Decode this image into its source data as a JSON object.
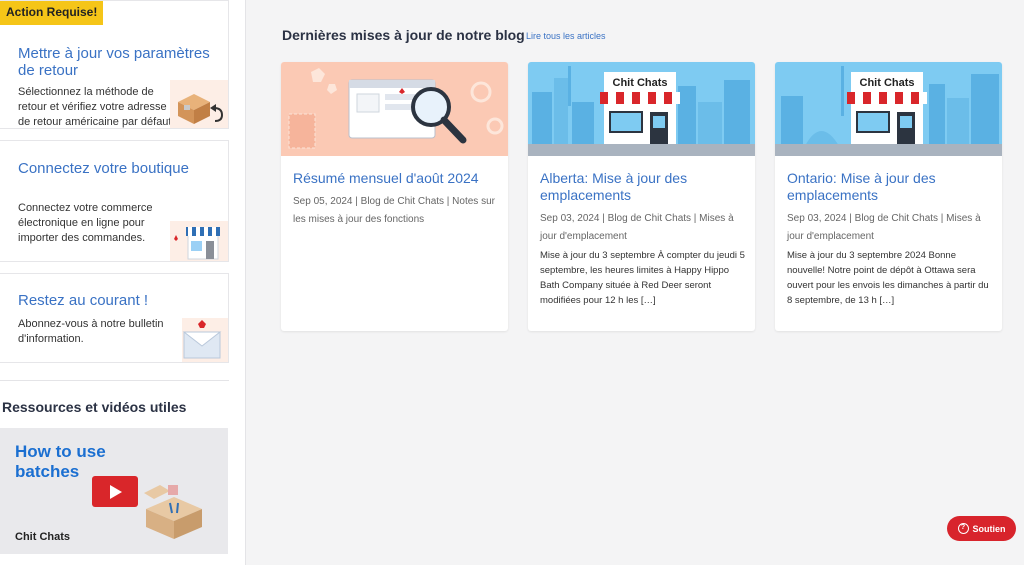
{
  "sidebar": {
    "cards": [
      {
        "badge": "Action Requise!",
        "title": "Mettre à jour vos paramètres de retour",
        "description": "Sélectionnez la méthode de retour et vérifiez votre adresse de retour américaine par défaut.",
        "icon": "return-box-icon"
      },
      {
        "title": "Connectez votre boutique",
        "description": "Connectez votre commerce électronique en ligne pour importer des commandes.",
        "icon": "storefront-icon"
      },
      {
        "title": "Restez au courant !",
        "description": "Abonnez-vous à notre bulletin d'information.",
        "icon": "envelope-icon"
      }
    ],
    "resources_title": "Ressources et vidéos utiles",
    "video": {
      "title": "How to use batches",
      "logo": "Chit Chats"
    }
  },
  "blog": {
    "header": "Dernières mises à jour de notre blog",
    "all_link": "Lire tous les articles",
    "posts": [
      {
        "title": "Résumé mensuel d'août 2024",
        "meta": "Sep 05, 2024 | Blog de Chit Chats | Notes sur les mises à jour des fonctions",
        "excerpt": ""
      },
      {
        "title": "Alberta: Mise à jour des emplacements",
        "meta": "Sep 03, 2024 | Blog de Chit Chats | Mises à jour d'emplacement",
        "excerpt": "Mise à jour du 3 septembre À compter du jeudi 5 septembre, les heures limites à Happy Hippo Bath Company située à Red Deer seront modifiées pour 12 h les […]",
        "sign": "Chit Chats"
      },
      {
        "title": "Ontario: Mise à jour des emplacements",
        "meta": "Sep 03, 2024 | Blog de Chit Chats | Mises à jour d'emplacement",
        "excerpt": "Mise à jour du 3 septembre 2024 Bonne nouvelle! Notre point de dépôt à Ottawa sera ouvert pour les envois les dimanches à partir du 8 septembre, de 13 h […]",
        "sign": "Chit Chats"
      }
    ]
  },
  "support": {
    "label": "Soutien"
  },
  "colors": {
    "accent_blue": "#3a72c4",
    "badge_yellow": "#f5c518",
    "support_red": "#d8242c",
    "sky_blue": "#7ecbf2"
  }
}
